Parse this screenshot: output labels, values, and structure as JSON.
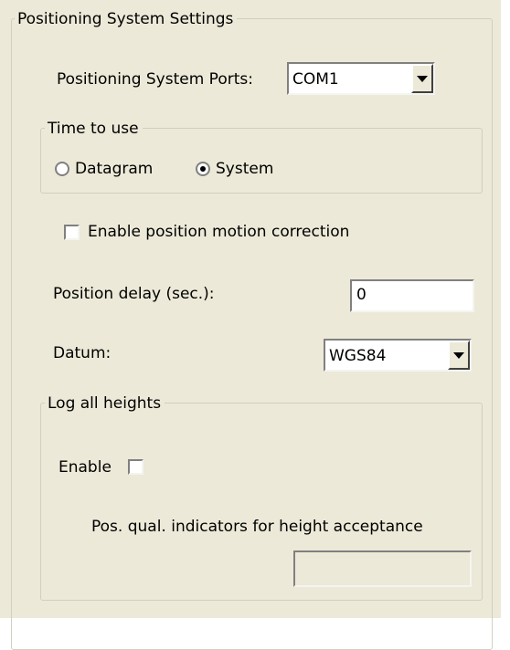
{
  "group": {
    "title": "Positioning System Settings"
  },
  "ports": {
    "label": "Positioning System Ports:",
    "value": "COM1"
  },
  "time_to_use": {
    "title": "Time to use",
    "options": [
      {
        "label": "Datagram",
        "selected": false
      },
      {
        "label": "System",
        "selected": true
      }
    ]
  },
  "motion_correction": {
    "label": "Enable position motion correction",
    "checked": false
  },
  "position_delay": {
    "label": "Position delay (sec.):",
    "value": "0"
  },
  "datum": {
    "label": "Datum:",
    "value": "WGS84"
  },
  "log_heights": {
    "title": "Log all heights",
    "enable_label": "Enable",
    "enable_checked": false,
    "indicator_label": "Pos. qual. indicators for height acceptance",
    "indicator_value": ""
  }
}
